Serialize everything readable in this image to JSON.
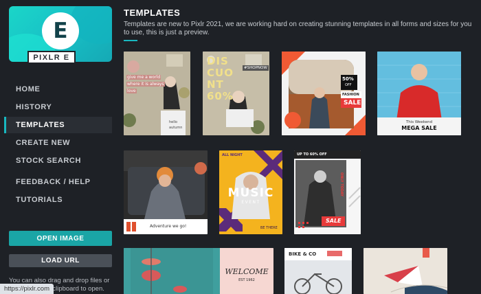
{
  "app": {
    "logo_letter": "E",
    "logo_name": "PIXLR E"
  },
  "sidebar": {
    "items": [
      {
        "label": "HOME"
      },
      {
        "label": "HISTORY"
      },
      {
        "label": "TEMPLATES"
      },
      {
        "label": "CREATE NEW"
      },
      {
        "label": "STOCK SEARCH"
      },
      {
        "label": "FEEDBACK / HELP"
      },
      {
        "label": "TUTORIALS"
      }
    ],
    "active": "TEMPLATES",
    "open_image": "OPEN IMAGE",
    "load_url": "LOAD URL",
    "hint": "You can also drag and drop files or paste from the clipboard to open."
  },
  "status_bar": {
    "url": "https://pixlr.com"
  },
  "main": {
    "title": "TEMPLATES",
    "description": "Templates are new to Pixlr 2021, we are working hard on creating stunning templates in all forms and sizes for you to use, this is just a preview."
  },
  "templates": {
    "t1": {
      "text1": "give me a world",
      "text2": "where it is always",
      "text3": "love",
      "text4": "hello",
      "text5": "autumn"
    },
    "t2": {
      "big": "DIS CUO NT 60%",
      "tag": "#SHOPNOW"
    },
    "t3": {
      "pct": "50%",
      "off": "OFF",
      "fashion": "FASHION",
      "sale": "SALE"
    },
    "t4": {
      "small": "This Weekend",
      "big": "MEGA SALE"
    },
    "t5": {
      "caption": "Adventure we go!"
    },
    "t6": {
      "top": "ALL NIGHT",
      "big": "MUSIC",
      "sub": "EVENT",
      "small": "BE THERE"
    },
    "t7": {
      "top": "UP TO 60% OFF",
      "side": "ONLY TODAY",
      "sale": "SALE"
    },
    "t9": {
      "title": "BIKE & CO"
    },
    "t8": {
      "welcome": "WELCOME",
      "est": "EST 1962"
    }
  },
  "colors": {
    "accent": "#18b8c0",
    "open_button": "#1aa5a6",
    "sale_red": "#e83a3a",
    "purple": "#5b2b7a"
  }
}
